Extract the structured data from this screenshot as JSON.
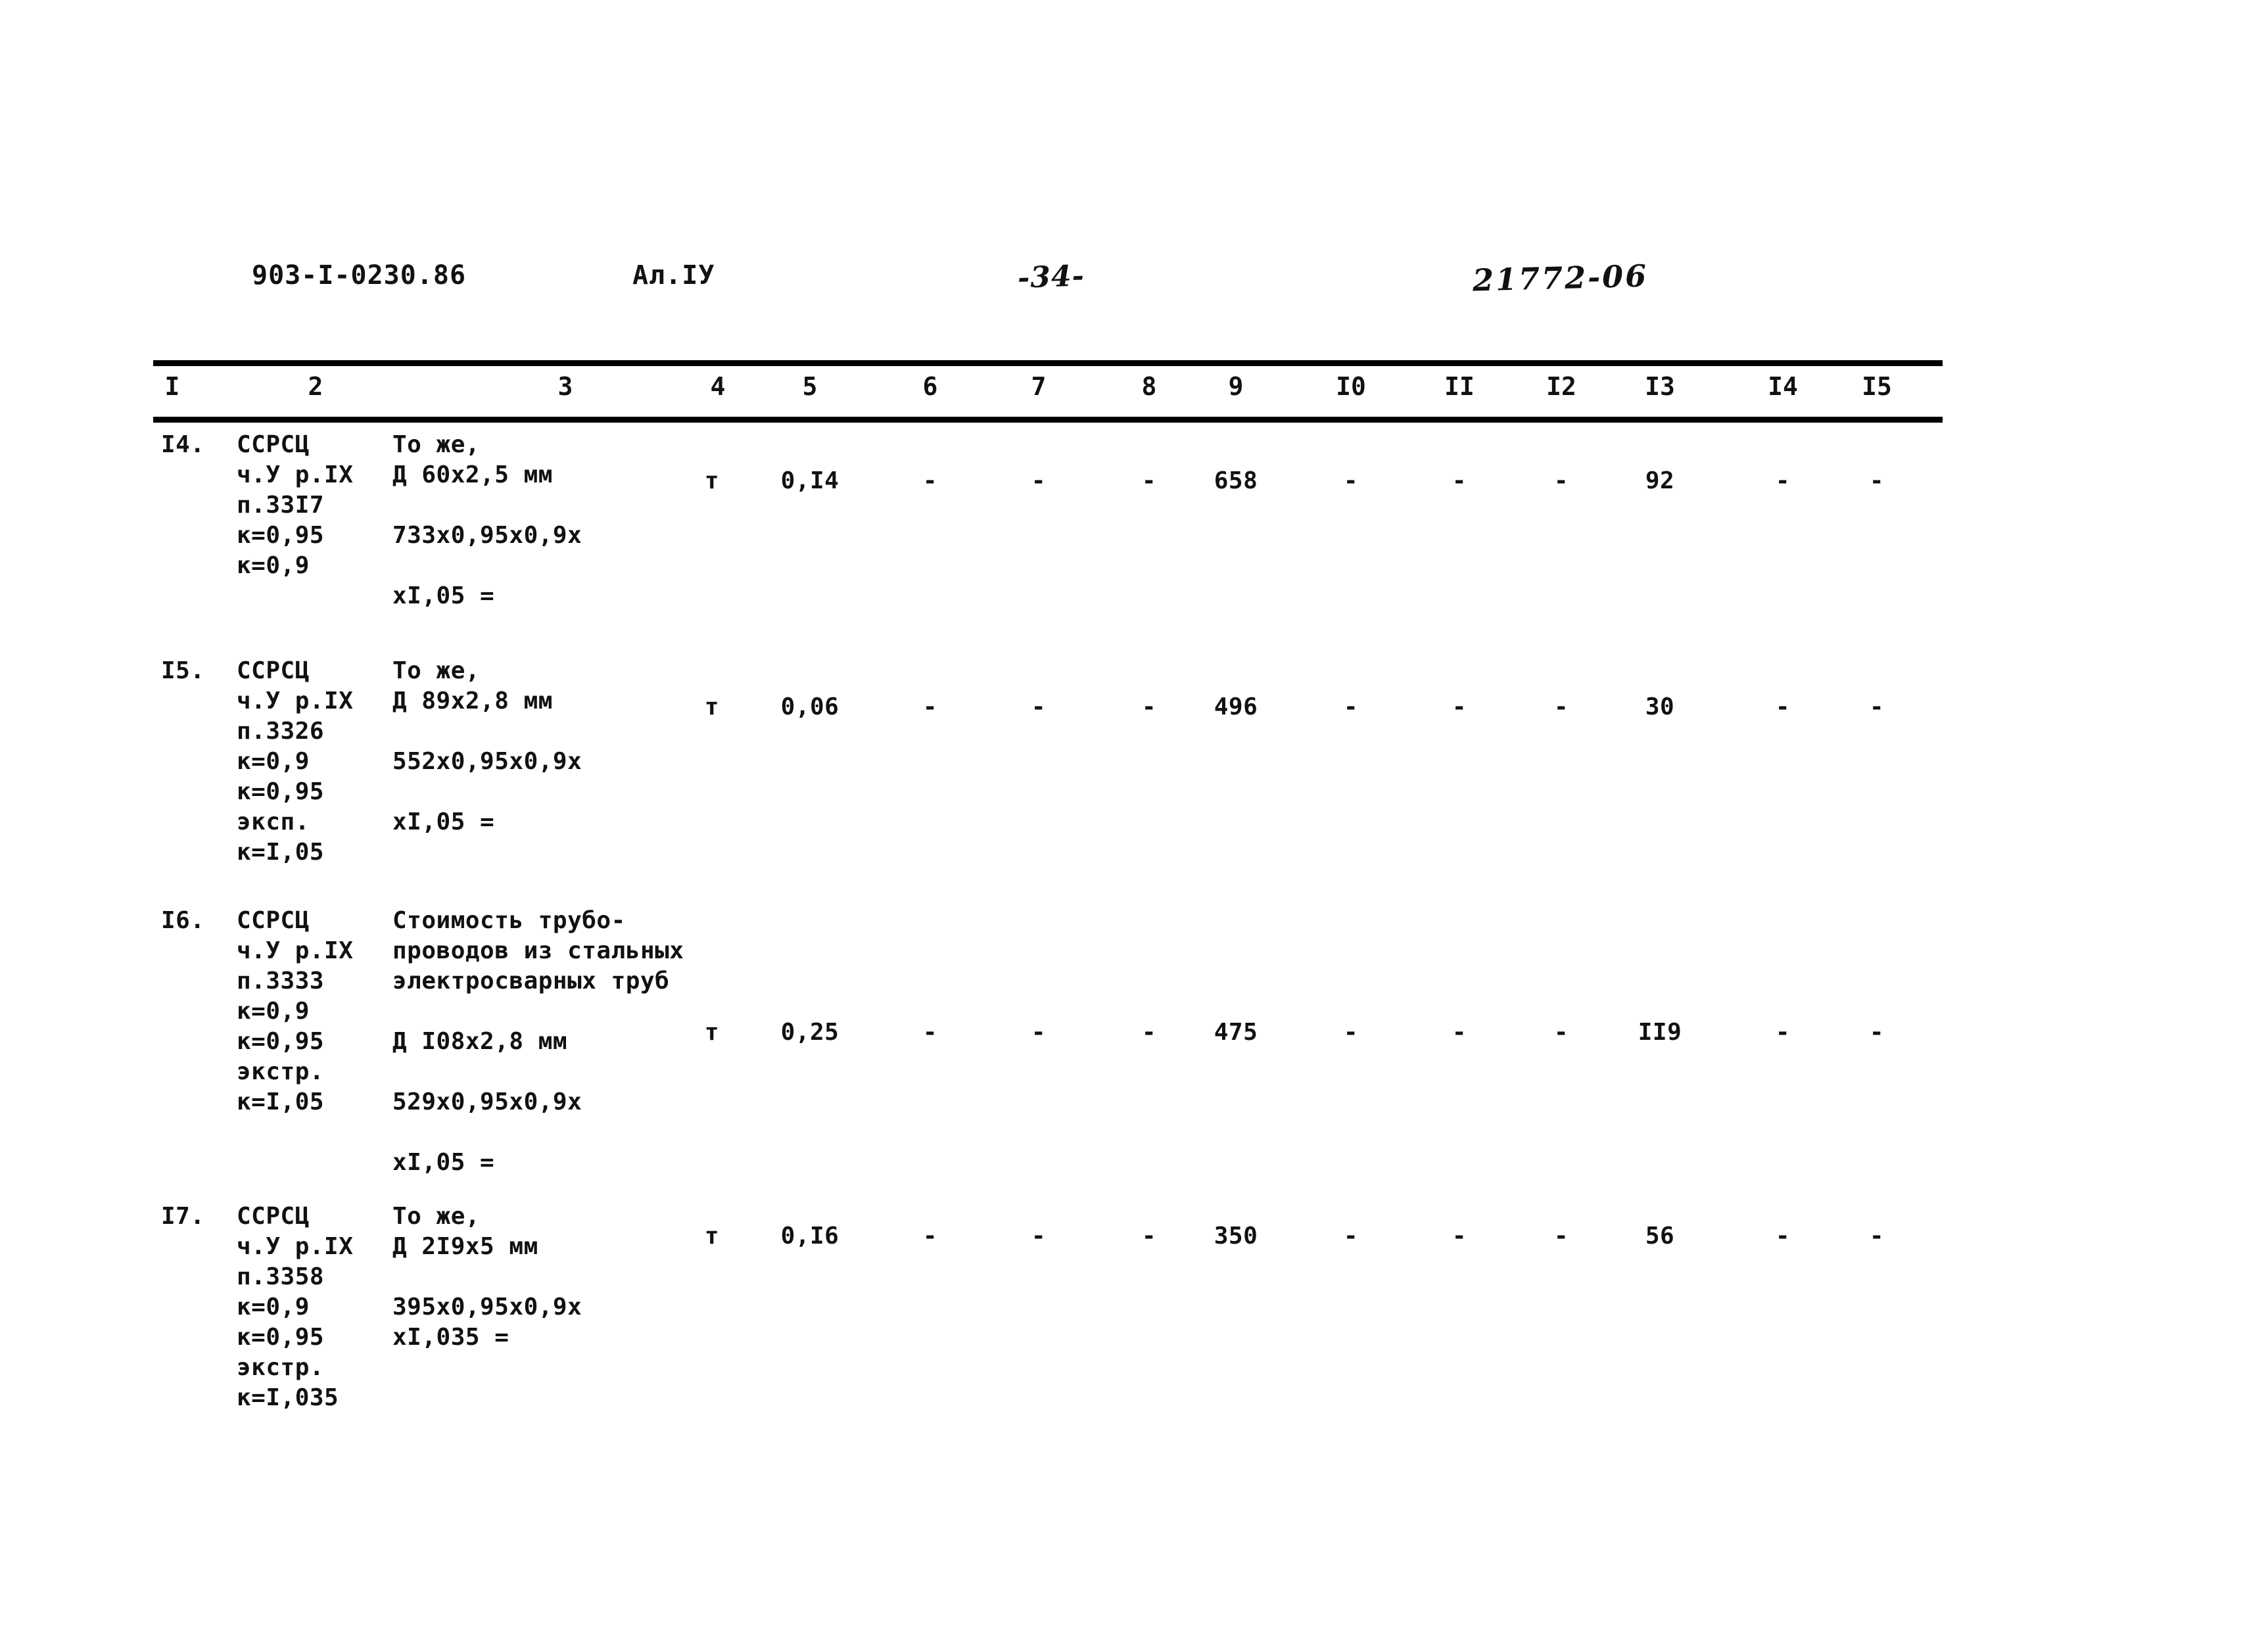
{
  "header": {
    "doc_code": "903-I-0230.86",
    "album": "Ал.IУ",
    "page_number": "-34-",
    "stamp_code": "21772-06"
  },
  "table": {
    "column_headers": [
      "I",
      "2",
      "3",
      "4",
      "5",
      "6",
      "7",
      "8",
      "9",
      "I0",
      "II",
      "I2",
      "I3",
      "I4",
      "I5"
    ],
    "rows": [
      {
        "num": "I4.",
        "justification": "ССРСЦ\nч.У р.IX\nп.33I7\nк=0,95\nк=0,9",
        "description": "То же,\nД 60x2,5 мм\n\n733x0,95x0,9x\n\nxI,05 =",
        "unit": "т",
        "col5": "0,I4",
        "col6": "-",
        "col7": "-",
        "col8": "-",
        "col9": "658",
        "col10": "-",
        "col11": "-",
        "col12": "-",
        "col13": "92",
        "col14": "-",
        "col15": "-"
      },
      {
        "num": "I5.",
        "justification": "ССРСЦ\nч.У р.IX\nп.3326\nк=0,9\nк=0,95\nэксп.\nк=I,05",
        "description": "То же,\nД 89x2,8 мм\n\n552x0,95x0,9x\n\nxI,05 =",
        "unit": "т",
        "col5": "0,06",
        "col6": "-",
        "col7": "-",
        "col8": "-",
        "col9": "496",
        "col10": "-",
        "col11": "-",
        "col12": "-",
        "col13": "30",
        "col14": "-",
        "col15": "-"
      },
      {
        "num": "I6.",
        "justification": "ССРСЦ\nч.У р.IX\nп.3333\nк=0,9\nк=0,95\nэкстр.\nк=I,05",
        "description": "Стоимость трубо-\nпроводов из стальных\nэлектросварных труб\n\nД I08x2,8 мм\n\n529x0,95x0,9x\n\nxI,05 =",
        "unit": "т",
        "col5": "0,25",
        "col6": "-",
        "col7": "-",
        "col8": "-",
        "col9": "475",
        "col10": "-",
        "col11": "-",
        "col12": "-",
        "col13": "II9",
        "col14": "-",
        "col15": "-"
      },
      {
        "num": "I7.",
        "justification": "ССРСЦ\nч.У р.IX\nп.3358\nк=0,9\nк=0,95\nэкстр.\nк=I,035",
        "description": "То же,\nД 2I9x5 мм\n\n395x0,95x0,9x\nxI,035 =",
        "unit": "т",
        "col5": "0,I6",
        "col6": "-",
        "col7": "-",
        "col8": "-",
        "col9": "350",
        "col10": "-",
        "col11": "-",
        "col12": "-",
        "col13": "56",
        "col14": "-",
        "col15": "-"
      }
    ]
  }
}
